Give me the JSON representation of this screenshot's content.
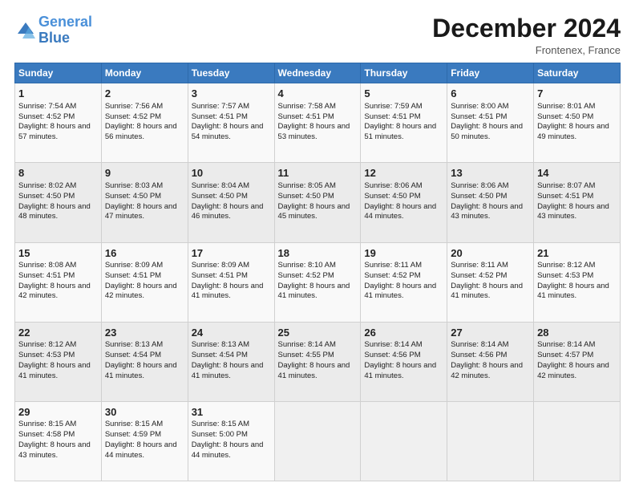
{
  "header": {
    "logo_line1": "General",
    "logo_line2": "Blue",
    "month": "December 2024",
    "location": "Frontenex, France"
  },
  "days_of_week": [
    "Sunday",
    "Monday",
    "Tuesday",
    "Wednesday",
    "Thursday",
    "Friday",
    "Saturday"
  ],
  "weeks": [
    [
      {
        "day": 1,
        "sunrise": "7:54 AM",
        "sunset": "4:52 PM",
        "daylight": "8 hours and 57 minutes."
      },
      {
        "day": 2,
        "sunrise": "7:56 AM",
        "sunset": "4:52 PM",
        "daylight": "8 hours and 56 minutes."
      },
      {
        "day": 3,
        "sunrise": "7:57 AM",
        "sunset": "4:51 PM",
        "daylight": "8 hours and 54 minutes."
      },
      {
        "day": 4,
        "sunrise": "7:58 AM",
        "sunset": "4:51 PM",
        "daylight": "8 hours and 53 minutes."
      },
      {
        "day": 5,
        "sunrise": "7:59 AM",
        "sunset": "4:51 PM",
        "daylight": "8 hours and 51 minutes."
      },
      {
        "day": 6,
        "sunrise": "8:00 AM",
        "sunset": "4:51 PM",
        "daylight": "8 hours and 50 minutes."
      },
      {
        "day": 7,
        "sunrise": "8:01 AM",
        "sunset": "4:50 PM",
        "daylight": "8 hours and 49 minutes."
      }
    ],
    [
      {
        "day": 8,
        "sunrise": "8:02 AM",
        "sunset": "4:50 PM",
        "daylight": "8 hours and 48 minutes."
      },
      {
        "day": 9,
        "sunrise": "8:03 AM",
        "sunset": "4:50 PM",
        "daylight": "8 hours and 47 minutes."
      },
      {
        "day": 10,
        "sunrise": "8:04 AM",
        "sunset": "4:50 PM",
        "daylight": "8 hours and 46 minutes."
      },
      {
        "day": 11,
        "sunrise": "8:05 AM",
        "sunset": "4:50 PM",
        "daylight": "8 hours and 45 minutes."
      },
      {
        "day": 12,
        "sunrise": "8:06 AM",
        "sunset": "4:50 PM",
        "daylight": "8 hours and 44 minutes."
      },
      {
        "day": 13,
        "sunrise": "8:06 AM",
        "sunset": "4:50 PM",
        "daylight": "8 hours and 43 minutes."
      },
      {
        "day": 14,
        "sunrise": "8:07 AM",
        "sunset": "4:51 PM",
        "daylight": "8 hours and 43 minutes."
      }
    ],
    [
      {
        "day": 15,
        "sunrise": "8:08 AM",
        "sunset": "4:51 PM",
        "daylight": "8 hours and 42 minutes."
      },
      {
        "day": 16,
        "sunrise": "8:09 AM",
        "sunset": "4:51 PM",
        "daylight": "8 hours and 42 minutes."
      },
      {
        "day": 17,
        "sunrise": "8:09 AM",
        "sunset": "4:51 PM",
        "daylight": "8 hours and 41 minutes."
      },
      {
        "day": 18,
        "sunrise": "8:10 AM",
        "sunset": "4:52 PM",
        "daylight": "8 hours and 41 minutes."
      },
      {
        "day": 19,
        "sunrise": "8:11 AM",
        "sunset": "4:52 PM",
        "daylight": "8 hours and 41 minutes."
      },
      {
        "day": 20,
        "sunrise": "8:11 AM",
        "sunset": "4:52 PM",
        "daylight": "8 hours and 41 minutes."
      },
      {
        "day": 21,
        "sunrise": "8:12 AM",
        "sunset": "4:53 PM",
        "daylight": "8 hours and 41 minutes."
      }
    ],
    [
      {
        "day": 22,
        "sunrise": "8:12 AM",
        "sunset": "4:53 PM",
        "daylight": "8 hours and 41 minutes."
      },
      {
        "day": 23,
        "sunrise": "8:13 AM",
        "sunset": "4:54 PM",
        "daylight": "8 hours and 41 minutes."
      },
      {
        "day": 24,
        "sunrise": "8:13 AM",
        "sunset": "4:54 PM",
        "daylight": "8 hours and 41 minutes."
      },
      {
        "day": 25,
        "sunrise": "8:14 AM",
        "sunset": "4:55 PM",
        "daylight": "8 hours and 41 minutes."
      },
      {
        "day": 26,
        "sunrise": "8:14 AM",
        "sunset": "4:56 PM",
        "daylight": "8 hours and 41 minutes."
      },
      {
        "day": 27,
        "sunrise": "8:14 AM",
        "sunset": "4:56 PM",
        "daylight": "8 hours and 42 minutes."
      },
      {
        "day": 28,
        "sunrise": "8:14 AM",
        "sunset": "4:57 PM",
        "daylight": "8 hours and 42 minutes."
      }
    ],
    [
      {
        "day": 29,
        "sunrise": "8:15 AM",
        "sunset": "4:58 PM",
        "daylight": "8 hours and 43 minutes."
      },
      {
        "day": 30,
        "sunrise": "8:15 AM",
        "sunset": "4:59 PM",
        "daylight": "8 hours and 44 minutes."
      },
      {
        "day": 31,
        "sunrise": "8:15 AM",
        "sunset": "5:00 PM",
        "daylight": "8 hours and 44 minutes."
      },
      null,
      null,
      null,
      null
    ]
  ]
}
